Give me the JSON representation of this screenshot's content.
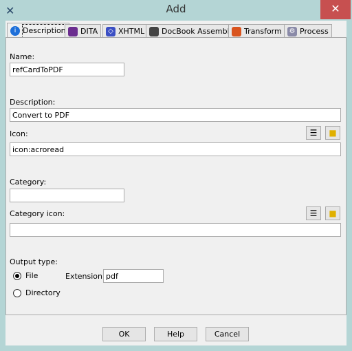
{
  "window": {
    "title": "Add",
    "close": "✕"
  },
  "tabs": [
    {
      "label": "Description",
      "icon": "info-icon",
      "color": "#1e6fd9"
    },
    {
      "label": "DITA",
      "icon": "dita-icon",
      "color": "#6b2d8f"
    },
    {
      "label": "XHTML",
      "icon": "xhtml-icon",
      "color": "#3b4fc4"
    },
    {
      "label": "DocBook Assembly",
      "icon": "docbook-icon",
      "color": "#444444"
    },
    {
      "label": "Transform",
      "icon": "transform-icon",
      "color": "#d9541e"
    },
    {
      "label": "Process",
      "icon": "gears-icon",
      "color": "#8a8aa8"
    }
  ],
  "form": {
    "name_label": "Name:",
    "name_value": "refCardToPDF",
    "description_label": "Description:",
    "description_value": "Convert to PDF",
    "icon_label": "Icon:",
    "icon_value": "icon:acroread",
    "category_label": "Category:",
    "category_value": "",
    "category_icon_label": "Category icon:",
    "category_icon_value": "",
    "output_type_label": "Output type:",
    "file_label": "File",
    "directory_label": "Directory",
    "selected": "File",
    "extension_label": "Extension:",
    "extension_value": "pdf"
  },
  "buttons": {
    "ok": "OK",
    "help": "Help",
    "cancel": "Cancel"
  }
}
